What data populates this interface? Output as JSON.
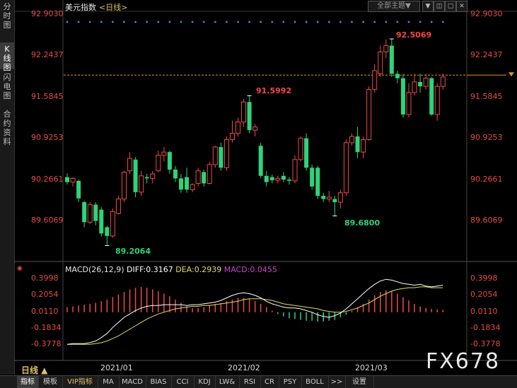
{
  "side_tabs": [
    {
      "label": "分时图",
      "active": false
    },
    {
      "label": "K线图",
      "active": true
    },
    {
      "label": "闪电图",
      "active": false
    },
    {
      "label": "合约资料",
      "active": false
    }
  ],
  "header": {
    "title": "美元指数",
    "period_link": "<日线>",
    "theme_button": "全部主题▼",
    "controls": [
      "▼",
      "◫",
      "▢",
      "✕"
    ]
  },
  "price_axis": {
    "labels": [
      "92.9030",
      "92.2437",
      "91.5845",
      "90.9253",
      "90.2661",
      "89.6069"
    ],
    "values": [
      92.903,
      92.2437,
      91.5845,
      90.9253,
      90.2661,
      89.6069
    ],
    "current_price_line": 91.93
  },
  "annotations": [
    {
      "text": "92.5069",
      "kind": "high"
    },
    {
      "text": "91.5992",
      "kind": "high"
    },
    {
      "text": "89.6800",
      "kind": "low"
    },
    {
      "text": "89.2064",
      "kind": "low"
    }
  ],
  "macd": {
    "legend": {
      "params": "MACD(26,12,9)",
      "diff": "DIFF:0.3167",
      "dea": "DEA:0.2939",
      "macd": "MACD:0.0455"
    },
    "axis_labels": [
      "0.3998",
      "0.2054",
      "0.0110",
      "-0.1834",
      "-0.3778"
    ],
    "axis_values": [
      0.3998,
      0.2054,
      0.011,
      -0.1834,
      -0.3778
    ]
  },
  "x_axis": [
    "2021/01",
    "2021/02",
    "2021/03"
  ],
  "period_badge": "日线 ▲",
  "watermark": "FX678",
  "bottom_tabs": [
    "指标",
    "模板",
    "VIP指标",
    "MA",
    "MACD",
    "BIAS",
    "CCI",
    "KDJ",
    "LW&",
    "RSI",
    "CR",
    "PSY",
    "BOLL",
    ">>",
    "设置"
  ],
  "colors": {
    "up": "#f04848",
    "down": "#2ed37a",
    "diff_line": "#ffffff",
    "dea_line": "#e6dc58",
    "macd_label": "#cc44cc",
    "dots": "#3a8ee6",
    "price_line": "#e8901e",
    "accent": "#e0c060"
  },
  "chart_data": {
    "type": "candlestick",
    "candles": [
      {
        "o": 90.3,
        "h": 90.36,
        "l": 90.18,
        "c": 90.22
      },
      {
        "o": 90.22,
        "h": 90.3,
        "l": 90.15,
        "c": 90.28
      },
      {
        "o": 90.24,
        "h": 90.26,
        "l": 89.9,
        "c": 89.96
      },
      {
        "o": 89.9,
        "h": 89.92,
        "l": 89.5,
        "c": 89.58
      },
      {
        "o": 89.58,
        "h": 89.9,
        "l": 89.55,
        "c": 89.86
      },
      {
        "o": 89.86,
        "h": 89.9,
        "l": 89.53,
        "c": 89.6
      },
      {
        "o": 89.78,
        "h": 89.82,
        "l": 89.35,
        "c": 89.4
      },
      {
        "o": 89.5,
        "h": 89.52,
        "l": 89.21,
        "c": 89.36
      },
      {
        "o": 89.36,
        "h": 89.8,
        "l": 89.33,
        "c": 89.75
      },
      {
        "o": 89.72,
        "h": 90.0,
        "l": 89.7,
        "c": 89.95
      },
      {
        "o": 89.95,
        "h": 90.4,
        "l": 89.9,
        "c": 90.38
      },
      {
        "o": 90.4,
        "h": 90.7,
        "l": 90.35,
        "c": 90.6
      },
      {
        "o": 90.58,
        "h": 90.62,
        "l": 89.98,
        "c": 90.06
      },
      {
        "o": 90.06,
        "h": 90.4,
        "l": 90.0,
        "c": 90.32
      },
      {
        "o": 90.3,
        "h": 90.35,
        "l": 90.2,
        "c": 90.28
      },
      {
        "o": 90.28,
        "h": 90.4,
        "l": 90.2,
        "c": 90.35
      },
      {
        "o": 90.4,
        "h": 90.72,
        "l": 90.38,
        "c": 90.65
      },
      {
        "o": 90.65,
        "h": 90.78,
        "l": 90.55,
        "c": 90.7
      },
      {
        "o": 90.7,
        "h": 90.72,
        "l": 90.35,
        "c": 90.42
      },
      {
        "o": 90.42,
        "h": 90.48,
        "l": 90.22,
        "c": 90.28
      },
      {
        "o": 90.28,
        "h": 90.35,
        "l": 90.05,
        "c": 90.1
      },
      {
        "o": 90.3,
        "h": 90.45,
        "l": 90.05,
        "c": 90.1
      },
      {
        "o": 90.1,
        "h": 90.2,
        "l": 90.06,
        "c": 90.18
      },
      {
        "o": 90.2,
        "h": 90.45,
        "l": 90.15,
        "c": 90.4
      },
      {
        "o": 90.38,
        "h": 90.42,
        "l": 90.15,
        "c": 90.2
      },
      {
        "o": 90.2,
        "h": 90.55,
        "l": 90.18,
        "c": 90.5
      },
      {
        "o": 90.5,
        "h": 90.8,
        "l": 90.45,
        "c": 90.78
      },
      {
        "o": 90.78,
        "h": 90.85,
        "l": 90.4,
        "c": 90.45
      },
      {
        "o": 90.45,
        "h": 90.95,
        "l": 90.4,
        "c": 90.9
      },
      {
        "o": 90.9,
        "h": 91.2,
        "l": 90.85,
        "c": 91.0
      },
      {
        "o": 91.0,
        "h": 91.25,
        "l": 90.95,
        "c": 91.18
      },
      {
        "o": 91.18,
        "h": 91.55,
        "l": 91.1,
        "c": 91.5
      },
      {
        "o": 91.5,
        "h": 91.6,
        "l": 91.0,
        "c": 91.05
      },
      {
        "o": 91.05,
        "h": 91.15,
        "l": 90.95,
        "c": 91.1
      },
      {
        "o": 90.8,
        "h": 90.85,
        "l": 90.28,
        "c": 90.32
      },
      {
        "o": 90.32,
        "h": 90.4,
        "l": 90.15,
        "c": 90.22
      },
      {
        "o": 90.3,
        "h": 90.34,
        "l": 90.2,
        "c": 90.25
      },
      {
        "o": 90.25,
        "h": 90.32,
        "l": 90.2,
        "c": 90.28
      },
      {
        "o": 90.32,
        "h": 90.38,
        "l": 90.22,
        "c": 90.26
      },
      {
        "o": 90.26,
        "h": 90.3,
        "l": 90.18,
        "c": 90.24
      },
      {
        "o": 90.24,
        "h": 90.65,
        "l": 90.2,
        "c": 90.58
      },
      {
        "o": 90.58,
        "h": 90.95,
        "l": 90.55,
        "c": 90.92
      },
      {
        "o": 90.92,
        "h": 91.0,
        "l": 90.4,
        "c": 90.45
      },
      {
        "o": 90.45,
        "h": 90.5,
        "l": 90.1,
        "c": 90.15
      },
      {
        "o": 90.45,
        "h": 90.48,
        "l": 89.95,
        "c": 90.0
      },
      {
        "o": 90.0,
        "h": 90.05,
        "l": 89.9,
        "c": 89.95
      },
      {
        "o": 89.95,
        "h": 90.08,
        "l": 89.9,
        "c": 89.98
      },
      {
        "o": 89.95,
        "h": 90.0,
        "l": 89.68,
        "c": 89.9
      },
      {
        "o": 89.9,
        "h": 90.1,
        "l": 89.8,
        "c": 90.05
      },
      {
        "o": 90.05,
        "h": 90.9,
        "l": 90.0,
        "c": 90.85
      },
      {
        "o": 90.85,
        "h": 91.0,
        "l": 90.8,
        "c": 90.95
      },
      {
        "o": 90.95,
        "h": 91.1,
        "l": 90.6,
        "c": 90.7
      },
      {
        "o": 90.7,
        "h": 90.95,
        "l": 90.6,
        "c": 90.9
      },
      {
        "o": 90.9,
        "h": 91.75,
        "l": 90.88,
        "c": 91.7
      },
      {
        "o": 91.7,
        "h": 92.1,
        "l": 91.65,
        "c": 92.0
      },
      {
        "o": 91.95,
        "h": 92.4,
        "l": 91.9,
        "c": 92.3
      },
      {
        "o": 92.3,
        "h": 92.5,
        "l": 92.2,
        "c": 92.4
      },
      {
        "o": 92.4,
        "h": 92.51,
        "l": 91.9,
        "c": 91.95
      },
      {
        "o": 91.95,
        "h": 92.0,
        "l": 91.8,
        "c": 91.88
      },
      {
        "o": 91.88,
        "h": 91.95,
        "l": 91.25,
        "c": 91.3
      },
      {
        "o": 91.3,
        "h": 91.8,
        "l": 91.25,
        "c": 91.65
      },
      {
        "o": 91.65,
        "h": 91.95,
        "l": 91.6,
        "c": 91.82
      },
      {
        "o": 91.82,
        "h": 91.95,
        "l": 91.65,
        "c": 91.75
      },
      {
        "o": 91.75,
        "h": 91.95,
        "l": 91.7,
        "c": 91.88
      },
      {
        "o": 91.88,
        "h": 91.9,
        "l": 91.28,
        "c": 91.3
      },
      {
        "o": 91.3,
        "h": 91.8,
        "l": 91.2,
        "c": 91.75
      },
      {
        "o": 91.75,
        "h": 91.95,
        "l": 91.7,
        "c": 91.9
      }
    ],
    "macd_hist": [
      0.06,
      0.07,
      0.08,
      0.09,
      0.1,
      0.11,
      0.13,
      0.15,
      0.18,
      0.21,
      0.24,
      0.27,
      0.29,
      0.3,
      0.29,
      0.27,
      0.25,
      0.22,
      0.19,
      0.15,
      0.11,
      0.07,
      0.05,
      0.05,
      0.06,
      0.08,
      0.1,
      0.11,
      0.13,
      0.15,
      0.17,
      0.17,
      0.16,
      0.13,
      0.1,
      0.06,
      0.02,
      -0.02,
      -0.05,
      -0.07,
      -0.08,
      -0.09,
      -0.1,
      -0.1,
      -0.11,
      -0.11,
      -0.1,
      -0.09,
      -0.06,
      -0.03,
      0.02,
      0.06,
      0.1,
      0.15,
      0.2,
      0.24,
      0.26,
      0.25,
      0.22,
      0.18,
      0.14,
      0.1,
      0.07,
      0.05,
      0.04,
      0.035,
      0.03
    ],
    "diff": [
      -0.38,
      -0.37,
      -0.37,
      -0.37,
      -0.36,
      -0.34,
      -0.3,
      -0.25,
      -0.18,
      -0.12,
      -0.06,
      -0.02,
      0.02,
      0.05,
      0.07,
      0.08,
      0.08,
      0.09,
      0.09,
      0.09,
      0.09,
      0.08,
      0.09,
      0.09,
      0.1,
      0.11,
      0.12,
      0.14,
      0.17,
      0.2,
      0.22,
      0.23,
      0.22,
      0.2,
      0.17,
      0.13,
      0.1,
      0.08,
      0.06,
      0.05,
      0.05,
      0.04,
      0.02,
      0.0,
      -0.03,
      -0.05,
      -0.06,
      -0.04,
      -0.01,
      0.04,
      0.1,
      0.16,
      0.22,
      0.28,
      0.33,
      0.37,
      0.39,
      0.38,
      0.36,
      0.34,
      0.33,
      0.32,
      0.33,
      0.31,
      0.3,
      0.31,
      0.32
    ],
    "dea": [
      -0.38,
      -0.38,
      -0.38,
      -0.38,
      -0.38,
      -0.37,
      -0.36,
      -0.34,
      -0.31,
      -0.28,
      -0.24,
      -0.2,
      -0.16,
      -0.12,
      -0.08,
      -0.05,
      -0.02,
      0.0,
      0.02,
      0.04,
      0.05,
      0.06,
      0.07,
      0.07,
      0.08,
      0.08,
      0.09,
      0.1,
      0.11,
      0.12,
      0.13,
      0.15,
      0.16,
      0.16,
      0.16,
      0.15,
      0.14,
      0.12,
      0.1,
      0.09,
      0.08,
      0.07,
      0.06,
      0.05,
      0.04,
      0.02,
      0.01,
      0.0,
      0.0,
      0.01,
      0.03,
      0.05,
      0.08,
      0.11,
      0.15,
      0.19,
      0.22,
      0.25,
      0.27,
      0.28,
      0.29,
      0.29,
      0.3,
      0.3,
      0.29,
      0.29,
      0.29
    ]
  }
}
